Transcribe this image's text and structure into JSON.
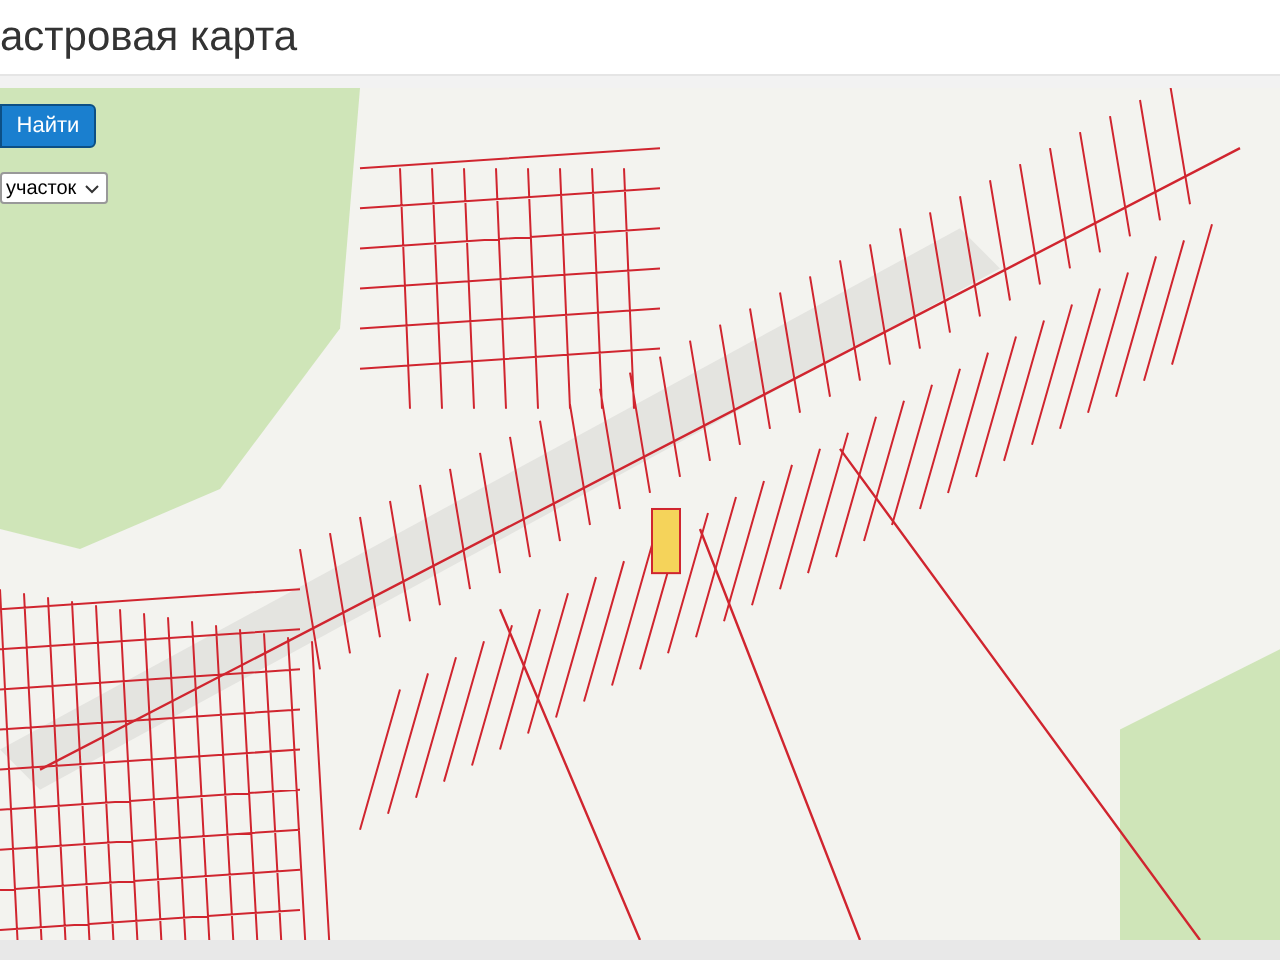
{
  "page_title": "астровая карта",
  "search_button": "Найти",
  "layer_select": {
    "value": "участок"
  }
}
